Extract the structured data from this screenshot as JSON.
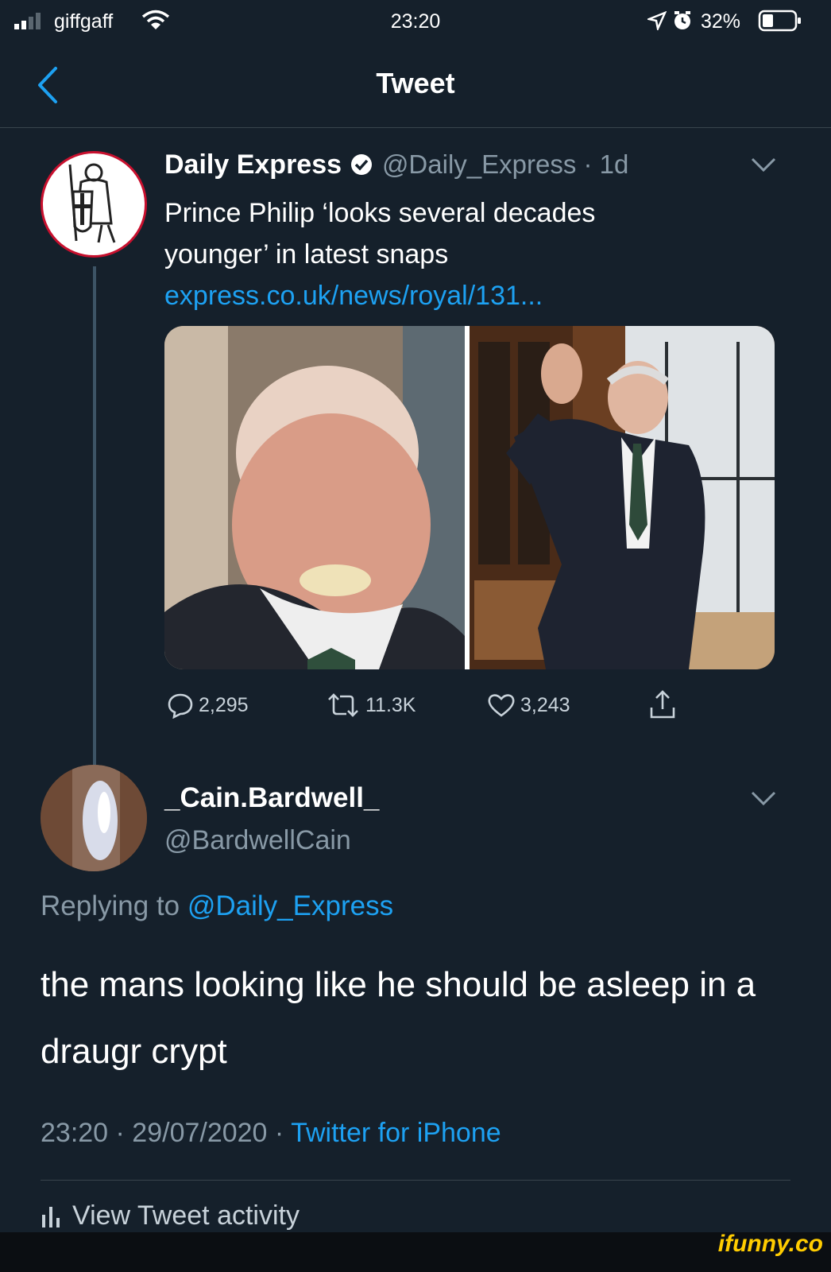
{
  "status_bar": {
    "carrier": "giffgaff",
    "time": "23:20",
    "battery": "32%"
  },
  "nav": {
    "title": "Tweet"
  },
  "original_tweet": {
    "display_name": "Daily Express",
    "handle": "@Daily_Express",
    "age": "1d",
    "text_line1": "Prince Philip ‘looks several decades",
    "text_line2": "younger’ in latest snaps",
    "link": "express.co.uk/news/royal/131...",
    "replies": "2,295",
    "retweets": "11.3K",
    "likes": "3,243"
  },
  "reply": {
    "display_name": "_Cain.Bardwell_",
    "handle": "@BardwellCain",
    "replying_prefix": "Replying to",
    "replying_to": "@Daily_Express",
    "text": "the mans looking like he should be asleep in a draugr crypt",
    "timestamp": "23:20 · 29/07/2020 ·",
    "client": "Twitter for iPhone"
  },
  "footer": {
    "activity": "View Tweet activity",
    "watermark": "ifunny.co"
  },
  "colors": {
    "background": "#15202b",
    "accent": "#1da1f2",
    "muted": "#8899a6"
  }
}
